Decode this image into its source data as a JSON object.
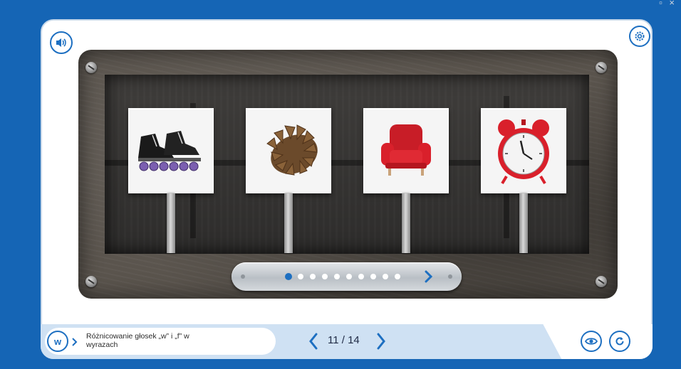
{
  "lesson": {
    "code_label": "w",
    "title": "Różnicowanie głosek „w” i „f” w wyrazach"
  },
  "pager": {
    "current": 11,
    "total": 14,
    "text": "11 / 14"
  },
  "slides": {
    "count": 10,
    "active_index": 0
  },
  "pictures": [
    {
      "id": "roller-skates",
      "icon": "roller-skates-icon"
    },
    {
      "id": "pine-cone",
      "icon": "pine-cone-icon"
    },
    {
      "id": "armchair",
      "icon": "armchair-icon"
    },
    {
      "id": "alarm-clock",
      "icon": "alarm-clock-icon"
    }
  ],
  "icons": {
    "audio": "speaker-icon",
    "settings": "gear-icon",
    "show": "eye-icon",
    "reset": "reset-icon",
    "next": "chevron-right-icon",
    "prev": "chevron-left-icon"
  },
  "colors": {
    "accent": "#1d6fc1",
    "background": "#1565b5",
    "armchair_red": "#d9202b",
    "clock_red": "#d9202b"
  }
}
